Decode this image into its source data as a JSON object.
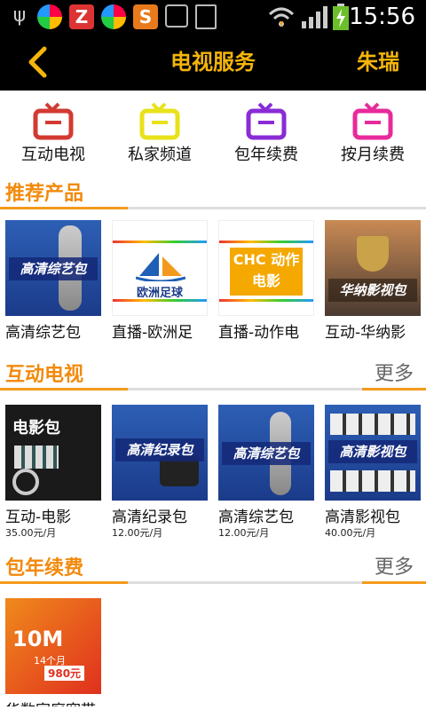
{
  "status_bar": {
    "time": "15:56"
  },
  "header": {
    "title": "电视服务",
    "username": "朱瑞"
  },
  "nav": [
    {
      "label": "互动电视",
      "color": "#d23a32"
    },
    {
      "label": "私家频道",
      "color": "#e8e21a"
    },
    {
      "label": "包年续费",
      "color": "#8a2bd6"
    },
    {
      "label": "按月续费",
      "color": "#e82a9a"
    }
  ],
  "recommended": {
    "title": "推荐产品",
    "items": [
      {
        "label": "高清综艺包",
        "thumb_text": "高清综艺包"
      },
      {
        "label": "直播-欧洲足",
        "thumb_text": "欧洲足球"
      },
      {
        "label": "直播-动作电",
        "thumb_text": "CHC 动作电影"
      },
      {
        "label": "互动-华纳影",
        "thumb_text": "华纳影视包"
      }
    ]
  },
  "interactive_tv": {
    "title": "互动电视",
    "more": "更多",
    "items": [
      {
        "label": "互动-电影",
        "price": "35.00元/月",
        "thumb_text": "电影包"
      },
      {
        "label": "高清纪录包",
        "price": "12.00元/月",
        "thumb_text": "高清纪录包"
      },
      {
        "label": "高清综艺包",
        "price": "12.00元/月",
        "thumb_text": "高清综艺包"
      },
      {
        "label": "高清影视包",
        "price": "40.00元/月",
        "thumb_text": "高清影视包"
      }
    ]
  },
  "annual": {
    "title": "包年续费",
    "more": "更多",
    "items": [
      {
        "label": "华数家庭宽带",
        "thumb_text": "10M",
        "thumb_sub": "14个月",
        "thumb_price": "980元"
      }
    ]
  }
}
